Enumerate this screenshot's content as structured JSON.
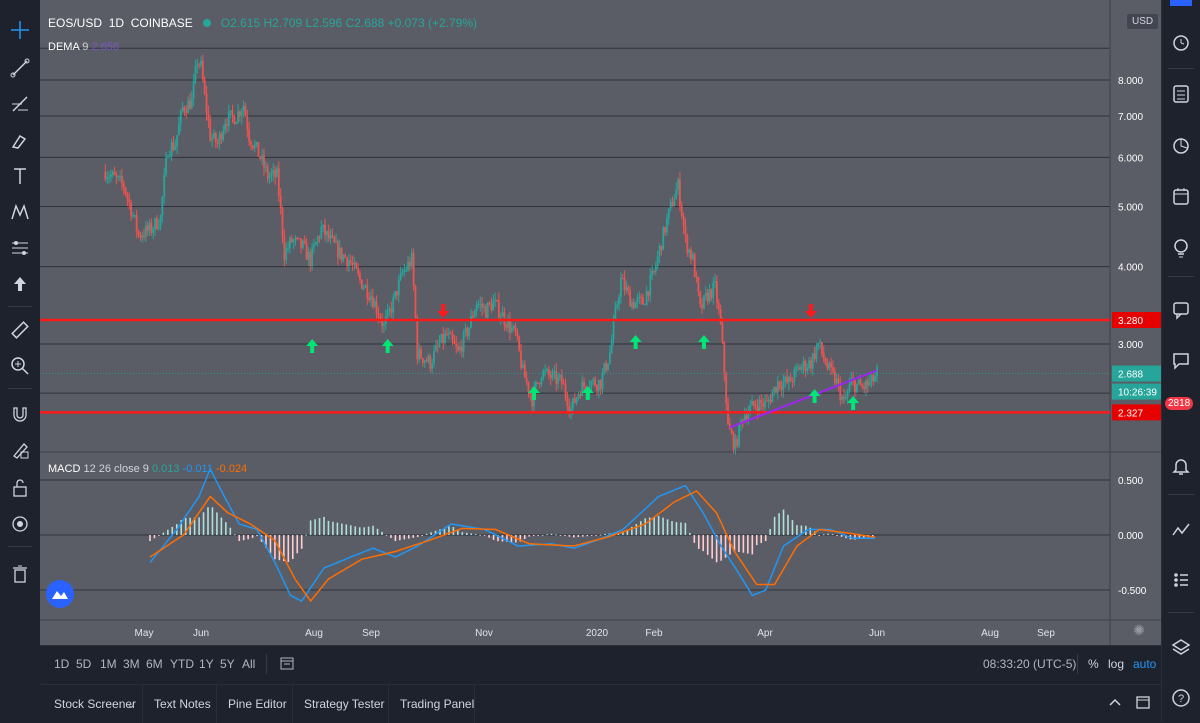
{
  "symbol": {
    "pair": "EOS/USD",
    "interval": "1D",
    "exchange": "COINBASE",
    "ohlc": {
      "o": "O2.615",
      "h": "H2.709",
      "l": "L2.596",
      "c": "C2.688",
      "chg": "+0.073 (+2.79%)"
    }
  },
  "dema": {
    "label": "DEMA",
    "period": "9",
    "value": "2.656"
  },
  "macd": {
    "label": "MACD",
    "params": "12 26 close 9",
    "hist": "0.013",
    "macd": "-0.011",
    "signal": "-0.024"
  },
  "price_scale": {
    "currency": "USD",
    "line_3280": "3.280",
    "line_2327": "2.327",
    "last": "2.688",
    "countdown": "10:26:39"
  },
  "notification_badge": "2818",
  "timeframes": [
    "1D",
    "5D",
    "1M",
    "3M",
    "6M",
    "YTD",
    "1Y",
    "5Y",
    "All"
  ],
  "clock": "08:33:20 (UTC-5)",
  "scale_options": {
    "percent": "%",
    "log": "log",
    "auto": "auto"
  },
  "bottom_tabs": [
    "Stock Screener",
    "Text Notes",
    "Pine Editor",
    "Strategy Tester",
    "Trading Panel"
  ],
  "colors": {
    "bg": "#5a5d66",
    "up": "#26a69a",
    "down": "#ef5350",
    "res_line": "#ff1a1a",
    "trend": "#9c27f0",
    "arrow_up": "#00e676",
    "arrow_down": "#ff1a1a",
    "macd": "#2196f3",
    "signal": "#ff6d00"
  },
  "chart_data": [
    {
      "type": "candlestick",
      "title": "EOS/USD 1D COINBASE",
      "x_ticks": [
        "May",
        "Jun",
        "Aug",
        "Sep",
        "Nov",
        "2020",
        "Feb",
        "Apr",
        "Jun",
        "Aug",
        "Sep"
      ],
      "y_ticks": [
        3.0,
        4.0,
        5.0,
        6.0,
        7.0,
        8.0
      ],
      "ylim": [
        2.0,
        9.0
      ],
      "log_scale": true,
      "grid": true,
      "horizontal_levels": [
        3.28,
        2.327
      ],
      "last_price": 2.688,
      "trendline": {
        "from": [
          "2020-03-13",
          2.2
        ],
        "to": [
          "2020-06-01",
          2.72
        ]
      },
      "buy_arrows": [
        "2019-07-31",
        "2019-09-10",
        "2019-11-28",
        "2019-12-27",
        "2020-01-22",
        "2020-02-28",
        "2020-04-28",
        "2020-05-19"
      ],
      "sell_arrows": [
        "2019-10-10",
        "2020-04-26"
      ],
      "close_path": [
        [
          "2019-04-10",
          5.7
        ],
        [
          "2019-04-20",
          5.4
        ],
        [
          "2019-04-28",
          4.5
        ],
        [
          "2019-05-05",
          4.6
        ],
        [
          "2019-05-10",
          4.8
        ],
        [
          "2019-05-14",
          6.2
        ],
        [
          "2019-05-18",
          6.3
        ],
        [
          "2019-05-22",
          7.2
        ],
        [
          "2019-05-27",
          7.4
        ],
        [
          "2019-05-30",
          8.6
        ],
        [
          "2019-06-01",
          8.4
        ],
        [
          "2019-06-03",
          7.5
        ],
        [
          "2019-06-06",
          6.5
        ],
        [
          "2019-06-10",
          6.3
        ],
        [
          "2019-06-14",
          6.9
        ],
        [
          "2019-06-20",
          7.0
        ],
        [
          "2019-06-24",
          7.3
        ],
        [
          "2019-06-27",
          6.5
        ],
        [
          "2019-07-03",
          6.0
        ],
        [
          "2019-07-07",
          5.6
        ],
        [
          "2019-07-12",
          5.6
        ],
        [
          "2019-07-16",
          4.2
        ],
        [
          "2019-07-20",
          4.4
        ],
        [
          "2019-07-26",
          4.3
        ],
        [
          "2019-07-30",
          4.1
        ],
        [
          "2019-08-05",
          4.6
        ],
        [
          "2019-08-10",
          4.4
        ],
        [
          "2019-08-15",
          4.2
        ],
        [
          "2019-08-20",
          4.1
        ],
        [
          "2019-08-26",
          3.8
        ],
        [
          "2019-09-01",
          3.6
        ],
        [
          "2019-09-08",
          3.2
        ],
        [
          "2019-09-13",
          3.5
        ],
        [
          "2019-09-18",
          3.9
        ],
        [
          "2019-09-23",
          4.1
        ],
        [
          "2019-09-26",
          2.9
        ],
        [
          "2019-10-03",
          2.8
        ],
        [
          "2019-10-08",
          3.0
        ],
        [
          "2019-10-12",
          3.1
        ],
        [
          "2019-10-18",
          2.9
        ],
        [
          "2019-10-24",
          3.2
        ],
        [
          "2019-10-28",
          3.5
        ],
        [
          "2019-11-02",
          3.4
        ],
        [
          "2019-11-06",
          3.5
        ],
        [
          "2019-11-12",
          3.3
        ],
        [
          "2019-11-18",
          3.1
        ],
        [
          "2019-11-22",
          2.7
        ],
        [
          "2019-11-27",
          2.45
        ],
        [
          "2019-12-02",
          2.7
        ],
        [
          "2019-12-08",
          2.65
        ],
        [
          "2019-12-13",
          2.6
        ],
        [
          "2019-12-18",
          2.35
        ],
        [
          "2019-12-23",
          2.55
        ],
        [
          "2019-12-28",
          2.6
        ],
        [
          "2020-01-03",
          2.6
        ],
        [
          "2020-01-08",
          2.9
        ],
        [
          "2020-01-14",
          3.8
        ],
        [
          "2020-01-20",
          3.5
        ],
        [
          "2020-01-26",
          3.5
        ],
        [
          "2020-02-01",
          3.9
        ],
        [
          "2020-02-06",
          4.5
        ],
        [
          "2020-02-11",
          5.1
        ],
        [
          "2020-02-14",
          5.4
        ],
        [
          "2020-02-18",
          4.4
        ],
        [
          "2020-02-22",
          4.1
        ],
        [
          "2020-02-26",
          3.4
        ],
        [
          "2020-03-01",
          3.6
        ],
        [
          "2020-03-05",
          3.7
        ],
        [
          "2020-03-08",
          3.2
        ],
        [
          "2020-03-12",
          2.2
        ],
        [
          "2020-03-16",
          2.05
        ],
        [
          "2020-03-20",
          2.3
        ],
        [
          "2020-03-27",
          2.4
        ],
        [
          "2020-04-02",
          2.4
        ],
        [
          "2020-04-08",
          2.6
        ],
        [
          "2020-04-14",
          2.6
        ],
        [
          "2020-04-20",
          2.75
        ],
        [
          "2020-04-26",
          2.8
        ],
        [
          "2020-04-30",
          3.0
        ],
        [
          "2020-05-05",
          2.75
        ],
        [
          "2020-05-10",
          2.6
        ],
        [
          "2020-05-14",
          2.4
        ],
        [
          "2020-05-18",
          2.6
        ],
        [
          "2020-05-24",
          2.55
        ],
        [
          "2020-05-29",
          2.6
        ],
        [
          "2020-06-01",
          2.688
        ]
      ]
    },
    {
      "type": "line",
      "title": "MACD 12 26 close 9",
      "y_ticks": [
        -0.5,
        0.0,
        0.5
      ],
      "ylim": [
        -0.72,
        0.72
      ],
      "series": [
        {
          "name": "MACD",
          "values": [
            [
              0,
              -0.25
            ],
            [
              12,
              0.05
            ],
            [
              22,
              0.35
            ],
            [
              27,
              0.6
            ],
            [
              32,
              0.4
            ],
            [
              40,
              0.1
            ],
            [
              48,
              0.05
            ],
            [
              56,
              -0.25
            ],
            [
              63,
              -0.55
            ],
            [
              68,
              -0.6
            ],
            [
              78,
              -0.3
            ],
            [
              90,
              -0.2
            ],
            [
              100,
              -0.12
            ],
            [
              110,
              -0.2
            ],
            [
              120,
              -0.1
            ],
            [
              135,
              0.1
            ],
            [
              150,
              0.05
            ],
            [
              165,
              -0.1
            ],
            [
              180,
              -0.08
            ],
            [
              190,
              -0.12
            ],
            [
              200,
              -0.05
            ],
            [
              212,
              0.05
            ],
            [
              220,
              0.2
            ],
            [
              228,
              0.35
            ],
            [
              240,
              0.45
            ],
            [
              248,
              0.2
            ],
            [
              256,
              -0.1
            ],
            [
              264,
              -0.35
            ],
            [
              270,
              -0.55
            ],
            [
              276,
              -0.5
            ],
            [
              284,
              -0.1
            ],
            [
              295,
              0.05
            ],
            [
              305,
              0.05
            ],
            [
              315,
              -0.03
            ],
            [
              325,
              -0.03
            ]
          ]
        },
        {
          "name": "Signal",
          "values": [
            [
              0,
              -0.2
            ],
            [
              15,
              0.0
            ],
            [
              27,
              0.35
            ],
            [
              35,
              0.2
            ],
            [
              45,
              0.1
            ],
            [
              56,
              -0.05
            ],
            [
              65,
              -0.4
            ],
            [
              72,
              -0.6
            ],
            [
              80,
              -0.4
            ],
            [
              95,
              -0.22
            ],
            [
              110,
              -0.15
            ],
            [
              125,
              -0.05
            ],
            [
              140,
              0.06
            ],
            [
              155,
              0.05
            ],
            [
              170,
              -0.08
            ],
            [
              190,
              -0.1
            ],
            [
              205,
              -0.02
            ],
            [
              222,
              0.1
            ],
            [
              235,
              0.3
            ],
            [
              245,
              0.4
            ],
            [
              254,
              0.2
            ],
            [
              262,
              -0.15
            ],
            [
              272,
              -0.45
            ],
            [
              280,
              -0.45
            ],
            [
              290,
              -0.1
            ],
            [
              300,
              0.05
            ],
            [
              312,
              0.02
            ],
            [
              325,
              -0.02
            ]
          ]
        }
      ]
    }
  ]
}
